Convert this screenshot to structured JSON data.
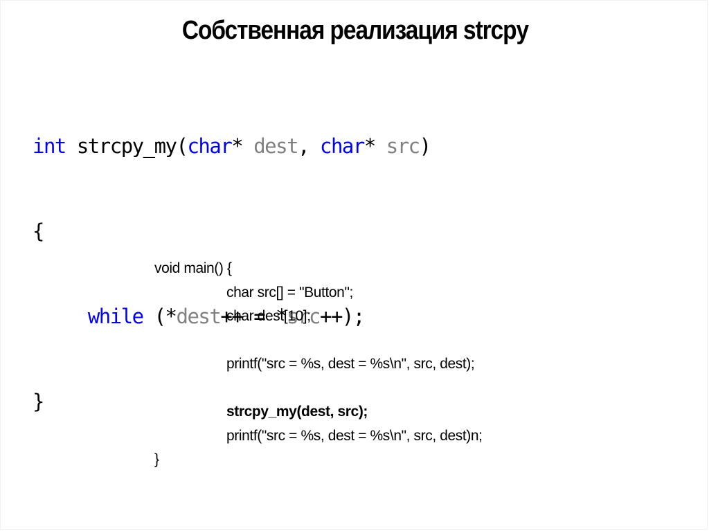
{
  "slide": {
    "title": "Собственная реализация strcpy",
    "function_code": {
      "line1": {
        "kw_int": "int",
        "name": " strcpy_my(",
        "kw_char1": "char",
        "star1": "* ",
        "param_dest": "dest",
        "comma": ", ",
        "kw_char2": "char",
        "star2": "* ",
        "param_src": "src",
        "close": ")"
      },
      "line2": "{",
      "line3": {
        "indent": "     ",
        "kw_while": "while",
        "open": " (*",
        "var_dest": "dest",
        "mid": "++ = *",
        "var_src": "src",
        "end": "++);"
      },
      "line4": "}"
    },
    "main_code": {
      "lines": [
        "void main() {",
        "char src[] = \"Button\";",
        "char dest[10];",
        "",
        "printf(\"src = %s, dest = %s\\n\", src, dest);",
        "",
        "strcpy_my(dest, src);",
        "printf(\"src = %s, dest = %s\\n\", src, dest)n;",
        "}"
      ]
    },
    "colors": {
      "keyword": "#0000ff",
      "parameter": "#808080",
      "text": "#000000"
    }
  }
}
